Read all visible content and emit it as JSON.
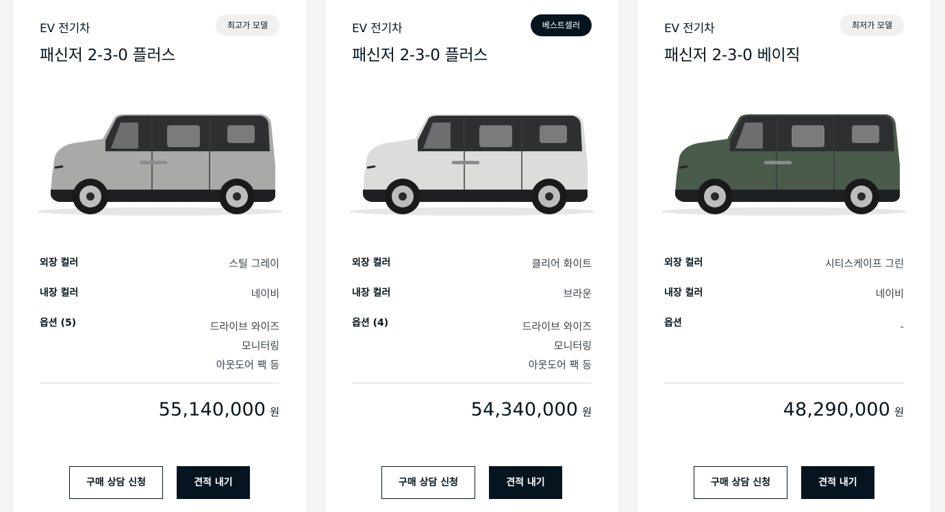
{
  "cards": [
    {
      "category": "EV 전기차",
      "badge": "최고가 모델",
      "badge_style": "light",
      "title": "패신저 2-3-0 플러스",
      "car_color": "#a9aaa8",
      "specs": {
        "exterior_label": "외장 컬러",
        "exterior_value": "스틸 그레이",
        "interior_label": "내장 컬러",
        "interior_value": "네이비",
        "options_label": "옵션 (5)",
        "options_values": [
          "드라이브 와이즈",
          "모니터링",
          "아웃도어 팩 등"
        ]
      },
      "price": "55,140,000",
      "price_unit": "원",
      "consult_button": "구매 상담 신청",
      "quote_button": "견적 내기"
    },
    {
      "category": "EV 전기차",
      "badge": "베스트셀러",
      "badge_style": "dark",
      "title": "패신저 2-3-0 플러스",
      "car_color": "#dcdcda",
      "specs": {
        "exterior_label": "외장 컬러",
        "exterior_value": "클리어 화이트",
        "interior_label": "내장 컬러",
        "interior_value": "브라운",
        "options_label": "옵션 (4)",
        "options_values": [
          "드라이브 와이즈",
          "모니터링",
          "아웃도어 팩 등"
        ]
      },
      "price": "54,340,000",
      "price_unit": "원",
      "consult_button": "구매 상담 신청",
      "quote_button": "견적 내기"
    },
    {
      "category": "EV 전기차",
      "badge": "최저가 모델",
      "badge_style": "light",
      "title": "패신저 2-3-0 베이직",
      "car_color": "#4a5b4b",
      "specs": {
        "exterior_label": "외장 컬러",
        "exterior_value": "시티스케이프 그린",
        "interior_label": "내장 컬러",
        "interior_value": "네이비",
        "options_label": "옵션",
        "options_values": [
          "-"
        ]
      },
      "price": "48,290,000",
      "price_unit": "원",
      "consult_button": "구매 상담 신청",
      "quote_button": "견적 내기"
    }
  ]
}
